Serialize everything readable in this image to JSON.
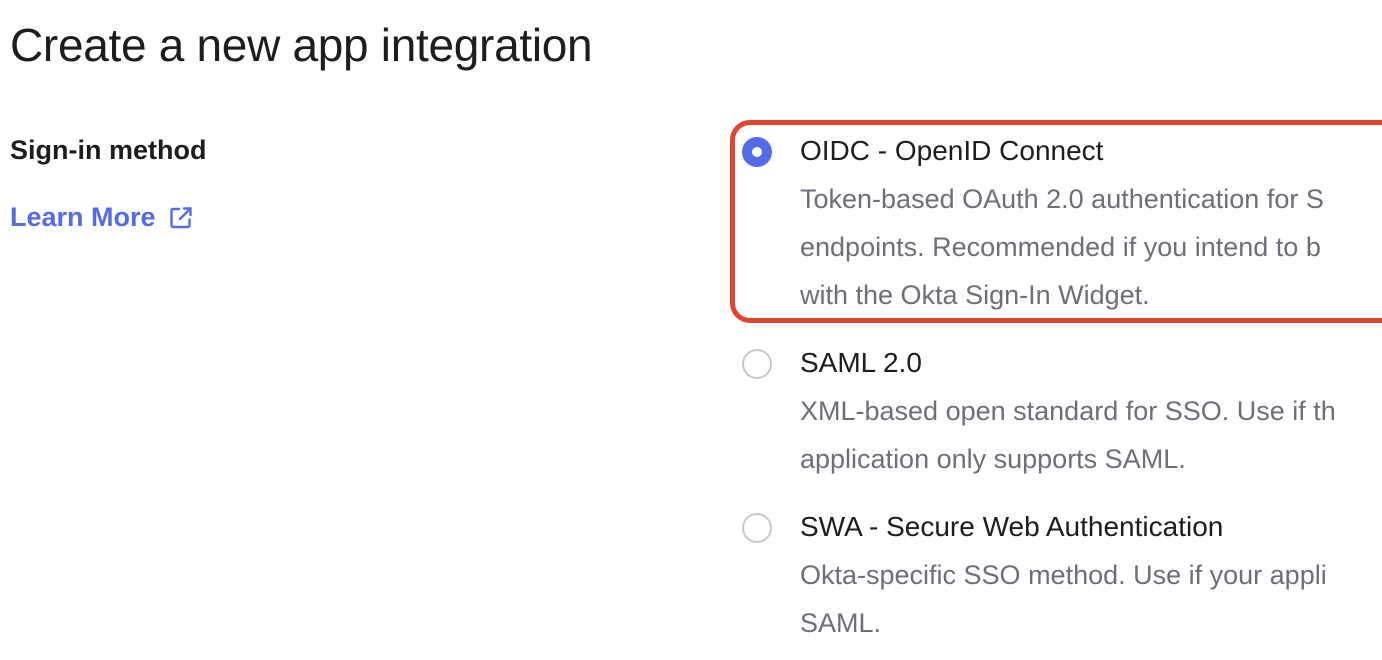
{
  "page": {
    "title": "Create a new app integration"
  },
  "sign_in": {
    "label": "Sign-in method",
    "learn_more": "Learn More",
    "learn_more_icon": "external-link-icon",
    "options": [
      {
        "title": "OIDC - OpenID Connect",
        "selected": true,
        "description_lines": [
          "Token-based OAuth 2.0 authentication for S",
          "endpoints. Recommended if you intend to b",
          "with the Okta Sign-In Widget."
        ]
      },
      {
        "title": "SAML 2.0",
        "selected": false,
        "description_lines": [
          "XML-based open standard for SSO. Use if th",
          "application only supports SAML."
        ]
      },
      {
        "title": "SWA - Secure Web Authentication",
        "selected": false,
        "description_lines": [
          "Okta-specific SSO method. Use if your appli",
          "SAML."
        ]
      }
    ]
  },
  "colors": {
    "accent": "#546be7",
    "highlight_border": "#e0442c",
    "title_text": "#1d1d21",
    "description_text": "#6e6e78"
  }
}
